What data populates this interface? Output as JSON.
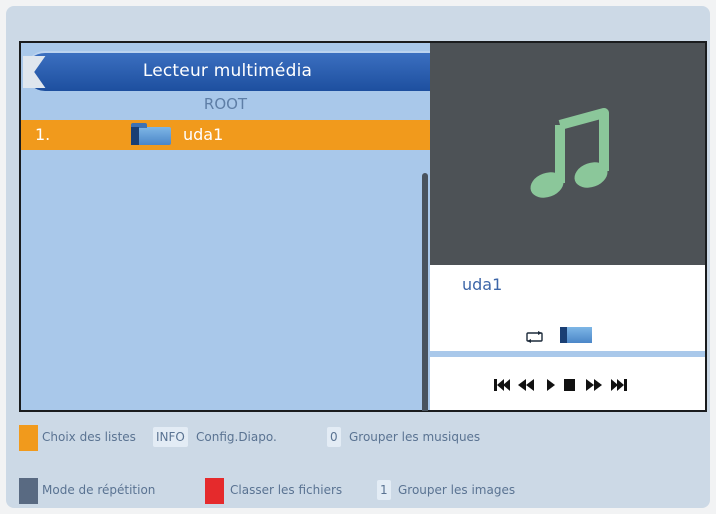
{
  "panel": {
    "title": "Lecteur multimédia",
    "folder": "ROOT",
    "items": [
      {
        "index": "1.",
        "name": "uda1",
        "selected": true
      }
    ]
  },
  "preview": {
    "icon": "music-note-icon",
    "name": "uda1",
    "transport_icons": [
      "skip-previous-icon",
      "rewind-icon",
      "play-icon",
      "stop-icon",
      "fast-forward-icon",
      "skip-next-icon"
    ]
  },
  "legend": {
    "row1": {
      "color": "#f19a1c",
      "choix_label": "Choix des listes",
      "info_key": "INFO",
      "info_label": "Config.Diapo.",
      "zero_key": "0",
      "zero_label": "Grouper les musiques"
    },
    "row2": {
      "blue_color": "#596a82",
      "mode_label": "Mode de répétition",
      "red_color": "#e52a2c",
      "classer_label": "Classer les fichiers",
      "one_key": "1",
      "one_label": "Grouper les images"
    }
  }
}
